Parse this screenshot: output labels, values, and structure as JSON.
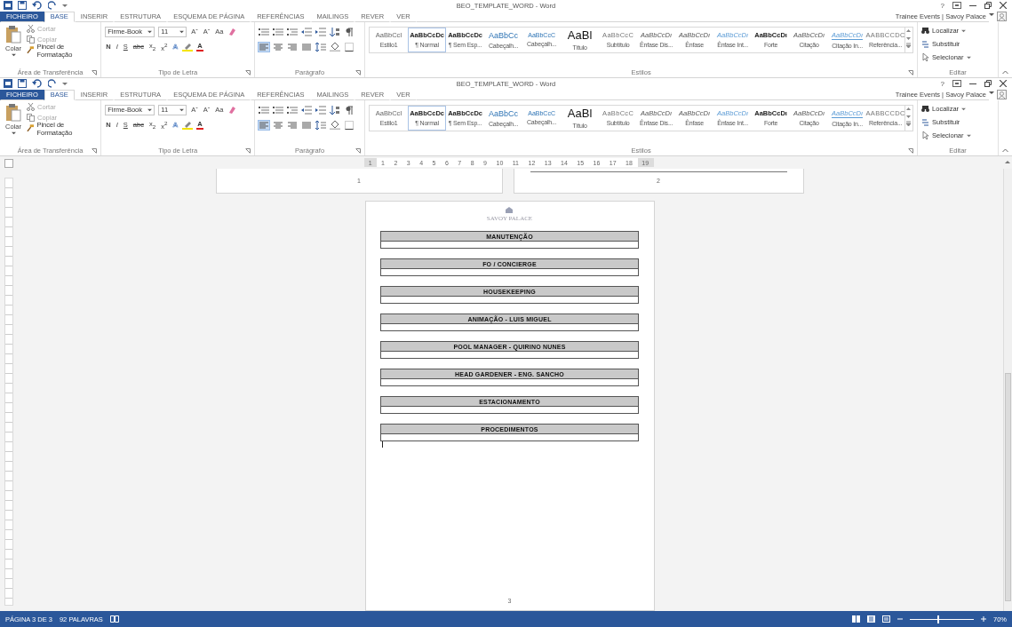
{
  "ribbon_copies": [
    {
      "title": "BEO_TEMPLATE_WORD - Word",
      "help": "?",
      "account": "Trainee Events | Savoy Palace",
      "tabs": [
        {
          "label": "FICHEIRO",
          "kind": "file",
          "selected": false
        },
        {
          "label": "BASE",
          "kind": "tab",
          "selected": true
        },
        {
          "label": "INSERIR",
          "kind": "tab",
          "selected": false
        },
        {
          "label": "ESTRUTURA",
          "kind": "tab",
          "selected": false
        },
        {
          "label": "ESQUEMA DE PÁGINA",
          "kind": "tab",
          "selected": false
        },
        {
          "label": "REFERÊNCIAS",
          "kind": "tab",
          "selected": false
        },
        {
          "label": "MAILINGS",
          "kind": "tab",
          "selected": false
        },
        {
          "label": "REVER",
          "kind": "tab",
          "selected": false
        },
        {
          "label": "VER",
          "kind": "tab",
          "selected": false
        }
      ],
      "clipboard": {
        "paste": "Colar",
        "items": [
          {
            "label": "Cortar",
            "kind": "cut",
            "disabled": true
          },
          {
            "label": "Copiar",
            "kind": "copy",
            "disabled": true
          },
          {
            "label": "Pincel de Formatação",
            "kind": "painter",
            "disabled": false
          }
        ],
        "label": "Área de Transferência"
      },
      "font": {
        "name": "Firme-Book",
        "size": "11",
        "row1": [
          "Aˆ",
          "Aˇ",
          "Aa"
        ],
        "row2": [
          "N",
          "I",
          "S",
          "abc",
          "x$_{2}$",
          "x$^{2}$"
        ],
        "effects": "A",
        "color_letter": "A",
        "label": "Tipo de Letra"
      },
      "paragraph": {
        "alignment_buttons": [
          {
            "selected": true
          },
          {
            "selected": false
          },
          {
            "selected": false
          },
          {
            "selected": false
          }
        ],
        "label": "Parágrafo"
      },
      "styles": {
        "items": [
          {
            "preview": "AaBbCcI",
            "name": "Estilo1",
            "kind": "plain",
            "selected": false
          },
          {
            "preview": "AaBbCcDc",
            "name": "¶ Normal",
            "kind": "bold",
            "selected": true
          },
          {
            "preview": "AaBbCcDc",
            "name": "¶ Sem Esp...",
            "kind": "bold",
            "selected": false
          },
          {
            "preview": "AaBbCc",
            "name": "Cabeçalh...",
            "kind": "heading1",
            "selected": false
          },
          {
            "preview": "AaBbCcC",
            "name": "Cabeçalh...",
            "kind": "heading2",
            "selected": false
          },
          {
            "preview": "AaBl",
            "name": "Título",
            "kind": "title",
            "selected": false
          },
          {
            "preview": "AaBbCcC",
            "name": "Subtítulo",
            "kind": "subtle",
            "selected": false
          },
          {
            "preview": "AaBbCcDı",
            "name": "Ênfase Dis...",
            "kind": "italic",
            "selected": false
          },
          {
            "preview": "AaBbCcDı",
            "name": "Ênfase",
            "kind": "italic",
            "selected": false
          },
          {
            "preview": "AaBbCcDı",
            "name": "Ênfase Int...",
            "kind": "blue",
            "selected": false
          },
          {
            "preview": "AaBbCcDı",
            "name": "Forte",
            "kind": "bold",
            "selected": false
          },
          {
            "preview": "AaBbCcDı",
            "name": "Citação",
            "kind": "italic",
            "selected": false
          },
          {
            "preview": "AaBbCcDı",
            "name": "Citação In...",
            "kind": "blueline",
            "selected": false
          },
          {
            "preview": "AABBCCDC",
            "name": "Referência...",
            "kind": "subtle",
            "selected": false
          }
        ],
        "label": "Estilos"
      },
      "editing": {
        "items": [
          {
            "label": "Localizar",
            "kind": "find"
          },
          {
            "label": "Substituir",
            "kind": "replace"
          },
          {
            "label": "Selecionar",
            "kind": "select"
          }
        ],
        "label": "Editar"
      }
    },
    {
      "title": "BEO_TEMPLATE_WORD - Word",
      "help": "?",
      "account": "Trainee Events | Savoy Palace",
      "tabs": [
        {
          "label": "FICHEIRO",
          "kind": "file",
          "selected": false
        },
        {
          "label": "BASE",
          "kind": "tab",
          "selected": true
        },
        {
          "label": "INSERIR",
          "kind": "tab",
          "selected": false
        },
        {
          "label": "ESTRUTURA",
          "kind": "tab",
          "selected": false
        },
        {
          "label": "ESQUEMA DE PÁGINA",
          "kind": "tab",
          "selected": false
        },
        {
          "label": "REFERÊNCIAS",
          "kind": "tab",
          "selected": false
        },
        {
          "label": "MAILINGS",
          "kind": "tab",
          "selected": false
        },
        {
          "label": "REVER",
          "kind": "tab",
          "selected": false
        },
        {
          "label": "VER",
          "kind": "tab",
          "selected": false
        }
      ],
      "clipboard": {
        "paste": "Colar",
        "items": [
          {
            "label": "Cortar",
            "kind": "cut",
            "disabled": true
          },
          {
            "label": "Copiar",
            "kind": "copy",
            "disabled": true
          },
          {
            "label": "Pincel de Formatação",
            "kind": "painter",
            "disabled": false
          }
        ],
        "label": "Área de Transferência"
      },
      "font": {
        "name": "Firme-Book",
        "size": "11",
        "row1": [
          "Aˆ",
          "Aˇ",
          "Aa"
        ],
        "row2": [
          "N",
          "I",
          "S",
          "abc",
          "x$_{2}$",
          "x$^{2}$"
        ],
        "effects": "A",
        "color_letter": "A",
        "label": "Tipo de Letra"
      },
      "paragraph": {
        "alignment_buttons": [
          {
            "selected": true
          },
          {
            "selected": false
          },
          {
            "selected": false
          },
          {
            "selected": false
          }
        ],
        "label": "Parágrafo"
      },
      "styles": {
        "items": [
          {
            "preview": "AaBbCcI",
            "name": "Estilo1",
            "kind": "plain",
            "selected": false
          },
          {
            "preview": "AaBbCcDc",
            "name": "¶ Normal",
            "kind": "bold",
            "selected": true
          },
          {
            "preview": "AaBbCcDc",
            "name": "¶ Sem Esp...",
            "kind": "bold",
            "selected": false
          },
          {
            "preview": "AaBbCc",
            "name": "Cabeçalh...",
            "kind": "heading1",
            "selected": false
          },
          {
            "preview": "AaBbCcC",
            "name": "Cabeçalh...",
            "kind": "heading2",
            "selected": false
          },
          {
            "preview": "AaBl",
            "name": "Título",
            "kind": "title",
            "selected": false
          },
          {
            "preview": "AaBbCcC",
            "name": "Subtítulo",
            "kind": "subtle",
            "selected": false
          },
          {
            "preview": "AaBbCcDı",
            "name": "Ênfase Dis...",
            "kind": "italic",
            "selected": false
          },
          {
            "preview": "AaBbCcDı",
            "name": "Ênfase",
            "kind": "italic",
            "selected": false
          },
          {
            "preview": "AaBbCcDı",
            "name": "Ênfase Int...",
            "kind": "blue",
            "selected": false
          },
          {
            "preview": "AaBbCcDı",
            "name": "Forte",
            "kind": "bold",
            "selected": false
          },
          {
            "preview": "AaBbCcDı",
            "name": "Citação",
            "kind": "italic",
            "selected": false
          },
          {
            "preview": "AaBbCcDı",
            "name": "Citação In...",
            "kind": "blueline",
            "selected": false
          },
          {
            "preview": "AABBCCDC",
            "name": "Referência...",
            "kind": "subtle",
            "selected": false
          }
        ],
        "label": "Estilos"
      },
      "editing": {
        "items": [
          {
            "label": "Localizar",
            "kind": "find"
          },
          {
            "label": "Substituir",
            "kind": "replace"
          },
          {
            "label": "Selecionar",
            "kind": "select"
          }
        ],
        "label": "Editar"
      }
    }
  ],
  "ruler": {
    "ticks": [
      "1",
      "1",
      "2",
      "3",
      "4",
      "5",
      "6",
      "7",
      "8",
      "9",
      "10",
      "11",
      "12",
      "13",
      "14",
      "15",
      "16",
      "17",
      "18",
      "19"
    ]
  },
  "previous_pages": [
    {
      "number": "1",
      "kind": "plain"
    },
    {
      "number": "2",
      "kind": "lined"
    }
  ],
  "page": {
    "logo_text": "SAVOY PALACE",
    "sections": [
      "MANUTENÇÃO",
      "FO / CONCIERGE",
      "HOUSEKEEPING",
      "ANIMAÇÃO - LUIS MIGUEL",
      "POOL MANAGER - QUIRINO NUNES",
      "HEAD GARDENER - ENG. SANCHO",
      "ESTACIONAMENTO",
      "PROCEDIMENTOS"
    ],
    "number": "3"
  },
  "status_bar": {
    "page": "PÁGINA 3 DE 3",
    "words": "92 PALAVRAS",
    "zoom": "70%",
    "zoom_slider": {
      "level": 0.45
    }
  }
}
